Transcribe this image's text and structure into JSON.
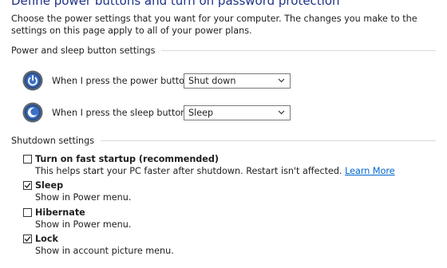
{
  "page": {
    "title": "Define power buttons and turn on password protection",
    "description": "Choose the power settings that you want for your computer. The changes you make to the settings on this page apply to all of your power plans."
  },
  "power_sleep_section": {
    "header": "Power and sleep button settings",
    "rows": [
      {
        "label": "When I press the power button:",
        "value": "Shut down",
        "icon": "power-icon"
      },
      {
        "label": "When I press the sleep button:",
        "value": "Sleep",
        "icon": "sleep-icon"
      }
    ]
  },
  "shutdown_section": {
    "header": "Shutdown settings",
    "options": [
      {
        "label": "Turn on fast startup (recommended)",
        "checked": false,
        "description": "This helps start your PC faster after shutdown. Restart isn't affected.",
        "link": "Learn More"
      },
      {
        "label": "Sleep",
        "checked": true,
        "description": "Show in Power menu."
      },
      {
        "label": "Hibernate",
        "checked": false,
        "description": "Show in Power menu."
      },
      {
        "label": "Lock",
        "checked": true,
        "description": "Show in account picture menu."
      }
    ]
  },
  "colors": {
    "title": "#1e3287",
    "link": "#0066cc"
  }
}
